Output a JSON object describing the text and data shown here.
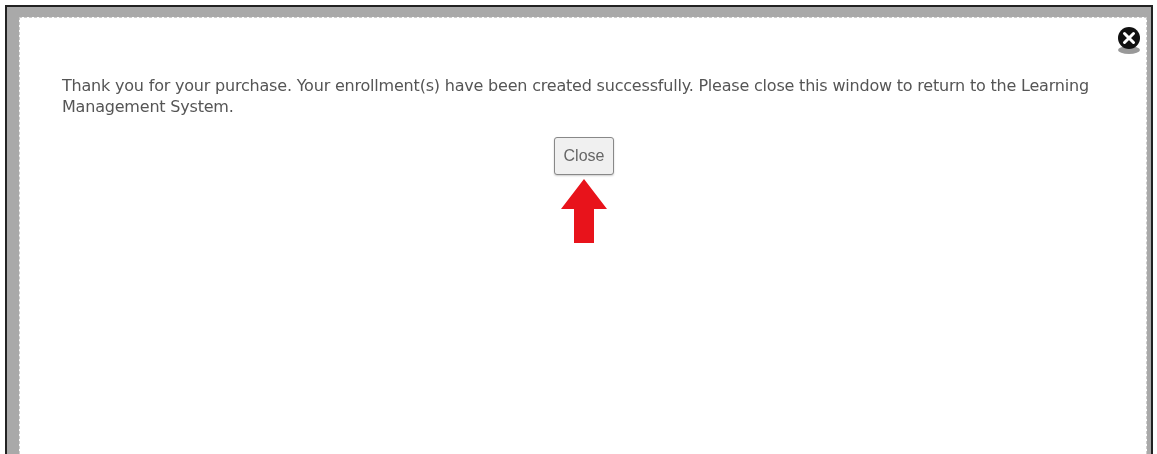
{
  "dialog": {
    "message": "Thank you for your purchase. Your enrollment(s) have been created successfully. Please close this window to return to the Learning Management System.",
    "button": "Close"
  }
}
